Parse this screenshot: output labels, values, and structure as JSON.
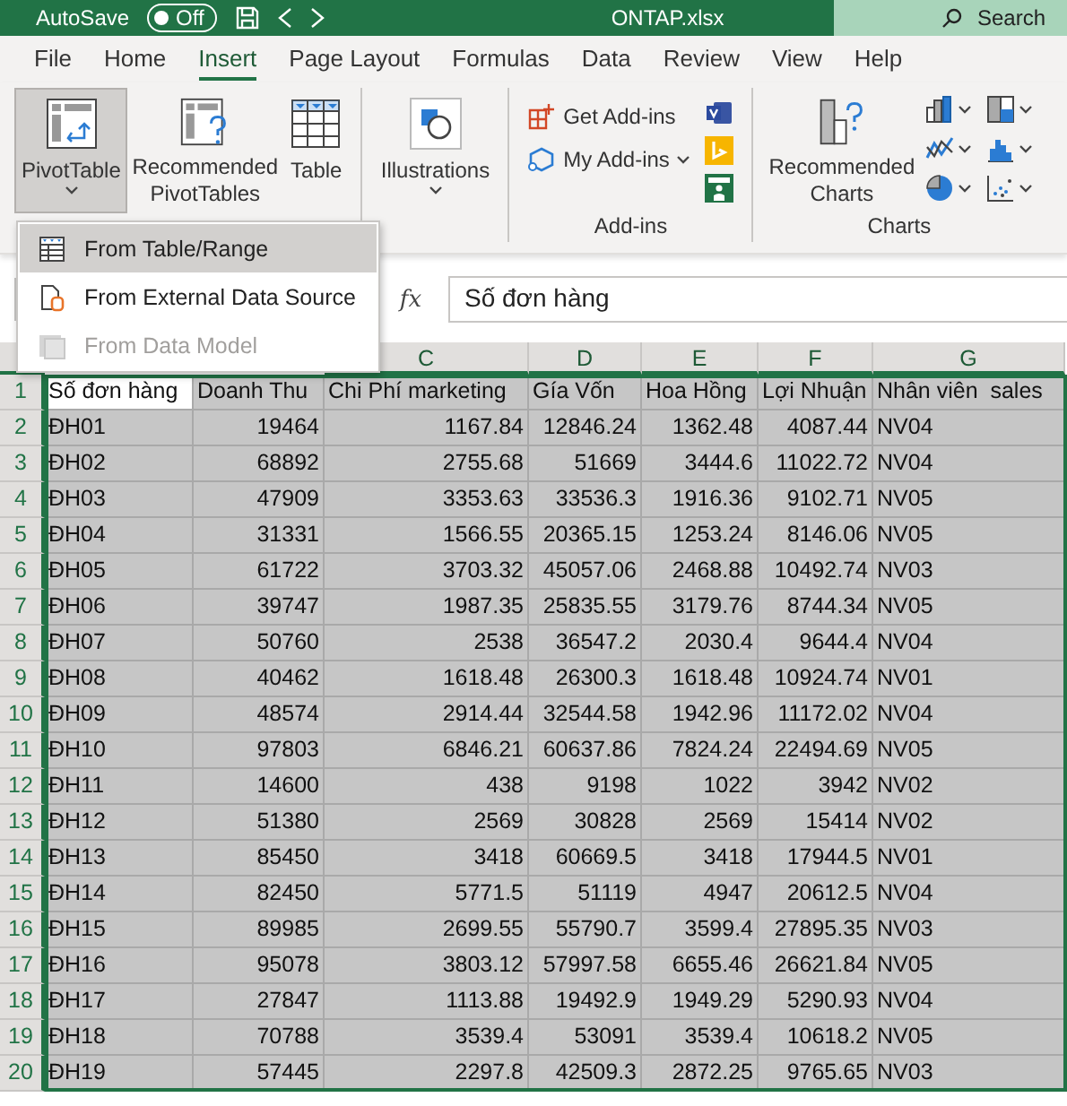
{
  "title_bar": {
    "autosave": "AutoSave",
    "toggle": {
      "label": "Off",
      "on": false
    },
    "filename": "ONTAP.xlsx",
    "search": "Search"
  },
  "tabs": [
    {
      "label": "File",
      "selected": false
    },
    {
      "label": "Home",
      "selected": false
    },
    {
      "label": "Insert",
      "selected": true
    },
    {
      "label": "Page Layout",
      "selected": false
    },
    {
      "label": "Formulas",
      "selected": false
    },
    {
      "label": "Data",
      "selected": false
    },
    {
      "label": "Review",
      "selected": false
    },
    {
      "label": "View",
      "selected": false
    },
    {
      "label": "Help",
      "selected": false
    }
  ],
  "ribbon": {
    "groups": [
      {
        "items": [
          {
            "kind": "large",
            "label": "PivotTable",
            "dropdown": true,
            "selected": true
          },
          {
            "kind": "large",
            "label": "Recommended PivotTables",
            "dropdown": false,
            "selected": false
          },
          {
            "kind": "large",
            "label": "Table",
            "dropdown": false,
            "selected": false
          }
        ]
      },
      {
        "items": [
          {
            "kind": "large",
            "label": "Illustrations",
            "dropdown": true,
            "selected": false
          }
        ]
      },
      {
        "label": "Add-ins",
        "items": [
          {
            "kind": "small",
            "label": "Get Add-ins",
            "dropdown": false
          },
          {
            "kind": "small",
            "label": "My Add-ins",
            "dropdown": true
          },
          {
            "kind": "apps"
          }
        ]
      },
      {
        "label": "Charts",
        "items": [
          {
            "kind": "large",
            "label": "Recommended Charts",
            "dropdown": false,
            "selected": false
          },
          {
            "kind": "charts"
          }
        ]
      }
    ]
  },
  "dropdown_menu": [
    {
      "label": "From Table/Range",
      "highlighted": true,
      "disabled": false
    },
    {
      "label": "From External Data Source",
      "highlighted": false,
      "disabled": false
    },
    {
      "label": "From Data Model",
      "highlighted": false,
      "disabled": true
    }
  ],
  "formula_bar": {
    "fx": "fx",
    "value": "Số đơn hàng"
  },
  "sheet": {
    "columns": [
      "",
      "",
      "C",
      "D",
      "E",
      "F",
      "G"
    ],
    "rows": [
      {
        "number": "1",
        "selected": true,
        "cells": [
          "Số đơn hàng",
          "Doanh Thu",
          "Chi Phí marketing",
          "Gía Vốn",
          "Hoa Hồng",
          "Lợi Nhuận",
          "Nhân viên  sales"
        ]
      },
      {
        "number": "2",
        "selected": true,
        "cells": [
          "ĐH01",
          "19464",
          "1167.84",
          "12846.24",
          "1362.48",
          "4087.44",
          "NV04"
        ]
      },
      {
        "number": "3",
        "selected": true,
        "cells": [
          "ĐH02",
          "68892",
          "2755.68",
          "51669",
          "3444.6",
          "11022.72",
          "NV04"
        ]
      },
      {
        "number": "4",
        "selected": true,
        "cells": [
          "ĐH03",
          "47909",
          "3353.63",
          "33536.3",
          "1916.36",
          "9102.71",
          "NV05"
        ]
      },
      {
        "number": "5",
        "selected": true,
        "cells": [
          "ĐH04",
          "31331",
          "1566.55",
          "20365.15",
          "1253.24",
          "8146.06",
          "NV05"
        ]
      },
      {
        "number": "6",
        "selected": true,
        "cells": [
          "ĐH05",
          "61722",
          "3703.32",
          "45057.06",
          "2468.88",
          "10492.74",
          "NV03"
        ]
      },
      {
        "number": "7",
        "selected": true,
        "cells": [
          "ĐH06",
          "39747",
          "1987.35",
          "25835.55",
          "3179.76",
          "8744.34",
          "NV05"
        ]
      },
      {
        "number": "8",
        "selected": true,
        "cells": [
          "ĐH07",
          "50760",
          "2538",
          "36547.2",
          "2030.4",
          "9644.4",
          "NV04"
        ]
      },
      {
        "number": "9",
        "selected": true,
        "cells": [
          "ĐH08",
          "40462",
          "1618.48",
          "26300.3",
          "1618.48",
          "10924.74",
          "NV01"
        ]
      },
      {
        "number": "10",
        "selected": true,
        "cells": [
          "ĐH09",
          "48574",
          "2914.44",
          "32544.58",
          "1942.96",
          "11172.02",
          "NV04"
        ]
      },
      {
        "number": "11",
        "selected": true,
        "cells": [
          "ĐH10",
          "97803",
          "6846.21",
          "60637.86",
          "7824.24",
          "22494.69",
          "NV05"
        ]
      },
      {
        "number": "12",
        "selected": true,
        "cells": [
          "ĐH11",
          "14600",
          "438",
          "9198",
          "1022",
          "3942",
          "NV02"
        ]
      },
      {
        "number": "13",
        "selected": true,
        "cells": [
          "ĐH12",
          "51380",
          "2569",
          "30828",
          "2569",
          "15414",
          "NV02"
        ]
      },
      {
        "number": "14",
        "selected": true,
        "cells": [
          "ĐH13",
          "85450",
          "3418",
          "60669.5",
          "3418",
          "17944.5",
          "NV01"
        ]
      },
      {
        "number": "15",
        "selected": true,
        "cells": [
          "ĐH14",
          "82450",
          "5771.5",
          "51119",
          "4947",
          "20612.5",
          "NV04"
        ]
      },
      {
        "number": "16",
        "selected": true,
        "cells": [
          "ĐH15",
          "89985",
          "2699.55",
          "55790.7",
          "3599.4",
          "27895.35",
          "NV03"
        ]
      },
      {
        "number": "17",
        "selected": true,
        "cells": [
          "ĐH16",
          "95078",
          "3803.12",
          "57997.58",
          "6655.46",
          "26621.84",
          "NV05"
        ]
      },
      {
        "number": "18",
        "selected": true,
        "cells": [
          "ĐH17",
          "27847",
          "1113.88",
          "19492.9",
          "1949.29",
          "5290.93",
          "NV04"
        ]
      },
      {
        "number": "19",
        "selected": true,
        "cells": [
          "ĐH18",
          "70788",
          "3539.4",
          "53091",
          "3539.4",
          "10618.2",
          "NV05"
        ]
      },
      {
        "number": "20",
        "selected": true,
        "cells": [
          "ĐH19",
          "57445",
          "2297.8",
          "42509.3",
          "2872.25",
          "9765.65",
          "NV03"
        ]
      }
    ]
  }
}
